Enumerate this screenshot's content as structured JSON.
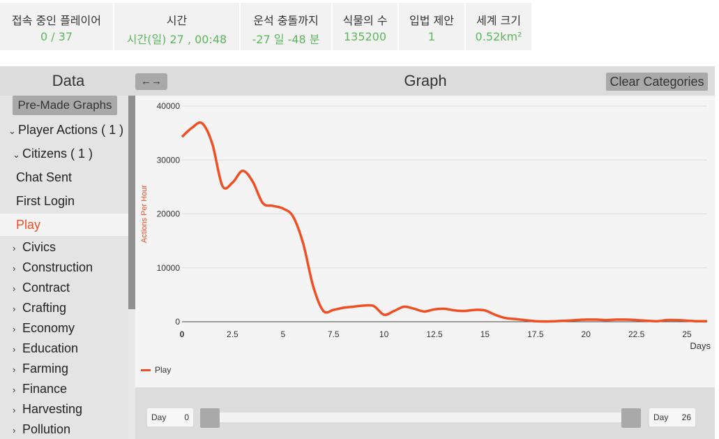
{
  "stats": [
    {
      "label": "접속 중인 플레이어",
      "value": "0 / 37"
    },
    {
      "label": "시간",
      "value": "시간(일) 27 , 00:48"
    },
    {
      "label": "운석 충돌까지",
      "value": "-27 일 -48 분"
    },
    {
      "label": "식물의 수",
      "value": "135200"
    },
    {
      "label": "입법 제안",
      "value": "1"
    },
    {
      "label": "세계 크기",
      "value": "0.52km²"
    }
  ],
  "panel": {
    "data_title": "Data",
    "swap_label": "←→",
    "graph_title": "Graph",
    "clear_label": "Clear Categories"
  },
  "sidebar": {
    "premade_label": "Pre-Made Graphs",
    "items": [
      {
        "label": "Player Actions",
        "count": "( 1 )",
        "chevron": "⌄"
      },
      {
        "label": "Citizens",
        "count": "( 1 )",
        "chevron": "⌄"
      },
      {
        "label": "Chat Sent",
        "count": "",
        "chevron": ""
      },
      {
        "label": "First Login",
        "count": "",
        "chevron": ""
      },
      {
        "label": "Play",
        "count": "",
        "chevron": ""
      },
      {
        "label": "Civics",
        "count": "",
        "chevron": "›"
      },
      {
        "label": "Construction",
        "count": "",
        "chevron": "›"
      },
      {
        "label": "Contract",
        "count": "",
        "chevron": "›"
      },
      {
        "label": "Crafting",
        "count": "",
        "chevron": "›"
      },
      {
        "label": "Economy",
        "count": "",
        "chevron": "›"
      },
      {
        "label": "Education",
        "count": "",
        "chevron": "›"
      },
      {
        "label": "Farming",
        "count": "",
        "chevron": "›"
      },
      {
        "label": "Finance",
        "count": "",
        "chevron": "›"
      },
      {
        "label": "Harvesting",
        "count": "",
        "chevron": "›"
      },
      {
        "label": "Pollution",
        "count": "",
        "chevron": "›"
      }
    ]
  },
  "slider": {
    "min_label": "Day",
    "min_value": "0",
    "max_label": "Day",
    "max_value": "26"
  },
  "chart_data": {
    "type": "line",
    "title": "",
    "xlabel": "Days",
    "ylabel": "Actions Per Hour",
    "xlim": [
      0,
      26
    ],
    "ylim": [
      0,
      40000
    ],
    "x_ticks": [
      0,
      2.5,
      5,
      7.5,
      10,
      12.5,
      15,
      17.5,
      20,
      22.5,
      25
    ],
    "y_ticks": [
      0,
      10000,
      20000,
      30000,
      40000
    ],
    "grid": true,
    "legend": "bottom-left",
    "color": "#f04e23",
    "series": [
      {
        "name": "Play",
        "x": [
          0,
          0.5,
          1,
          1.5,
          2,
          2.5,
          3,
          3.5,
          4,
          4.5,
          5,
          5.5,
          6,
          6.5,
          7,
          7.5,
          8,
          8.5,
          9,
          9.5,
          10,
          10.5,
          11,
          11.5,
          12,
          12.5,
          13,
          13.5,
          14,
          14.5,
          15,
          15.5,
          16,
          16.5,
          17,
          17.5,
          18,
          18.5,
          19,
          19.5,
          20,
          20.5,
          21,
          21.5,
          22,
          22.5,
          23,
          23.5,
          24,
          24.5,
          25,
          25.5,
          26
        ],
        "y": [
          34300,
          36000,
          36800,
          33000,
          25200,
          25800,
          28000,
          26000,
          22000,
          21500,
          21000,
          19500,
          14500,
          6500,
          2000,
          2200,
          2600,
          2800,
          3000,
          2900,
          1300,
          2000,
          2800,
          2400,
          1900,
          2300,
          2400,
          2100,
          2000,
          2200,
          2100,
          1300,
          700,
          500,
          300,
          100,
          50,
          100,
          200,
          300,
          400,
          400,
          300,
          400,
          400,
          300,
          200,
          100,
          300,
          300,
          200,
          100,
          100
        ]
      }
    ]
  }
}
